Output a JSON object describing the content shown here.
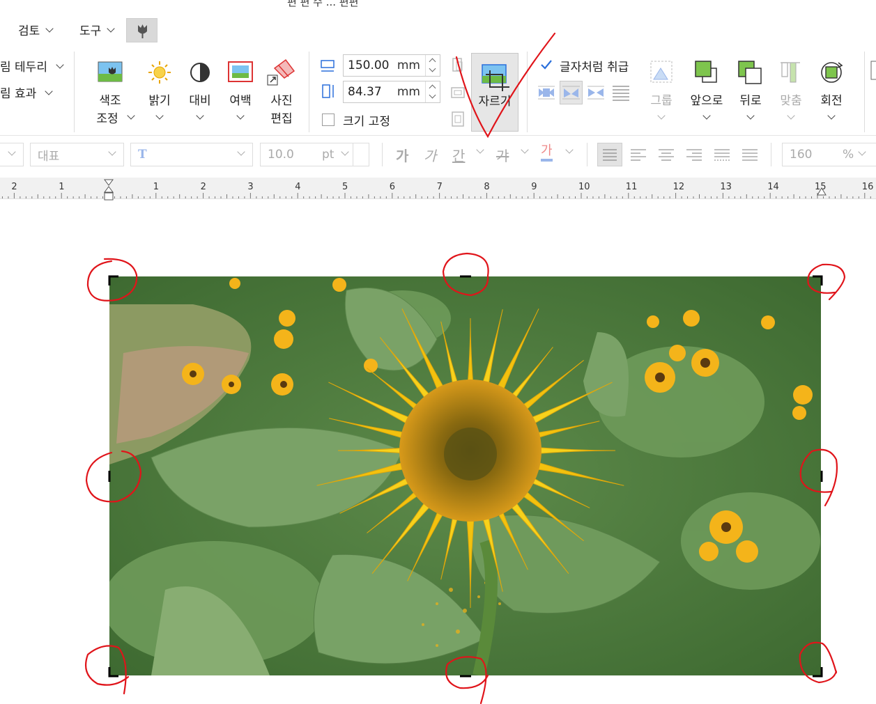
{
  "menu": {
    "top_partial": "편 편 수 ... 편편",
    "review": "검토",
    "tools": "도구"
  },
  "ribbon": {
    "border_label": "림 테두리",
    "effect_label": "림 효과",
    "color_adjust": [
      "색조",
      "조정"
    ],
    "brightness": "밝기",
    "contrast": "대비",
    "margin": "여백",
    "photo_edit": [
      "사진",
      "편집"
    ],
    "width_value": "150.00",
    "height_value": "84.37",
    "unit": "mm",
    "lock_size_label": "크기 고정",
    "crop_label": "자르기",
    "treat_as_char_label": "글자처럼 취급",
    "group": "그룹",
    "bring_forward": "앞으로",
    "send_backward": "뒤로",
    "align": "맞춤",
    "rotate": "회전"
  },
  "format_bar": {
    "style": "대표",
    "font_size": "10.0",
    "font_unit": "pt",
    "bold": "가",
    "italic": "가",
    "underline": "간",
    "strike": "갸",
    "font_color": "가",
    "zoom": "160",
    "zoom_unit": "%"
  },
  "ruler": {
    "labels": [
      "2",
      "1",
      "1",
      "2",
      "3",
      "4",
      "5",
      "6",
      "7",
      "8",
      "9",
      "10",
      "11",
      "12",
      "13",
      "14",
      "15",
      "16"
    ]
  },
  "colors": {
    "annotation_red": "#e0141a",
    "accent_blue": "#2a6fdb",
    "selected_button_bg": "#e6e6e6"
  }
}
